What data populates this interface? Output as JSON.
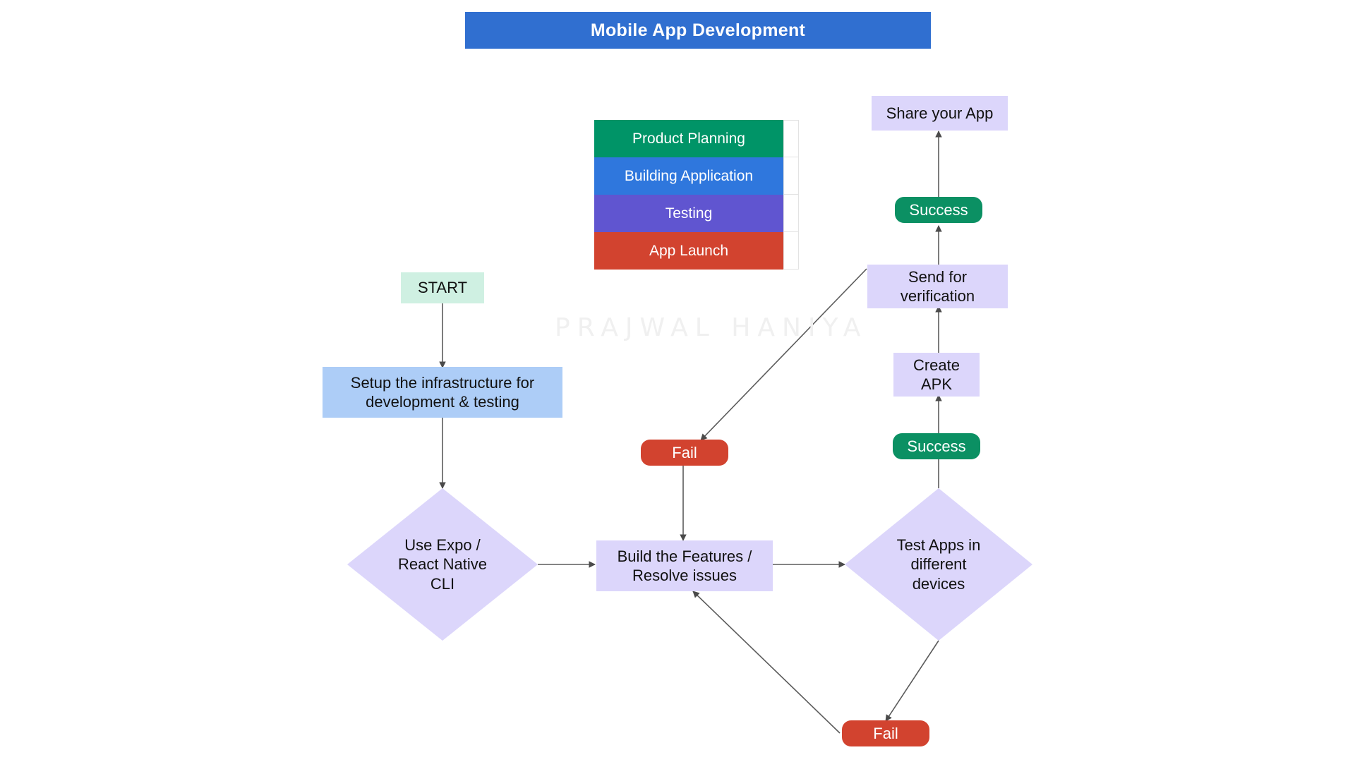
{
  "header": {
    "title": "Mobile App Development",
    "banner_color": "#306FD0"
  },
  "watermark": {
    "text": "PRAJWAL HANIYA"
  },
  "legend": {
    "rows": [
      {
        "label": "Product Planning",
        "color": "#009467"
      },
      {
        "label": "Building Application",
        "color": "#2F77DD"
      },
      {
        "label": "Testing",
        "color": "#6055D0"
      },
      {
        "label": "App Launch",
        "color": "#D2432F"
      }
    ]
  },
  "nodes": {
    "start": {
      "label": "START"
    },
    "setup": {
      "label": "Setup the infrastructure for\ndevelopment & testing"
    },
    "expo": {
      "label": "Use Expo /\nReact Native\nCLI"
    },
    "build": {
      "label": "Build the Features /\nResolve issues"
    },
    "test_devices": {
      "label": "Test Apps in\ndifferent\ndevices"
    },
    "create_apk": {
      "label": "Create\nAPK"
    },
    "send_verify": {
      "label": "Send for\nverification"
    },
    "share_app": {
      "label": "Share your App"
    }
  },
  "labels": {
    "success_test": "Success",
    "success_verify": "Success",
    "fail_verify": "Fail",
    "fail_test": "Fail"
  },
  "colors": {
    "lavender": "#DCD6FB",
    "mint": "#CFF0E2",
    "skyblue": "#ADCDF7",
    "success_green": "#0B9063",
    "fail_red": "#D2432F",
    "edge": "#5b5b5b"
  }
}
